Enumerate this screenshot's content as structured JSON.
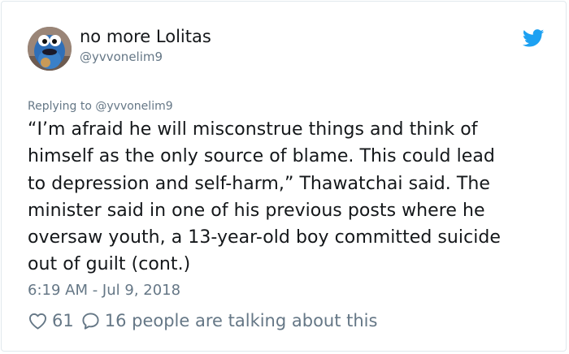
{
  "user": {
    "display_name": "no more Lolitas",
    "handle": "@yvvonelim9",
    "avatar": "cookie-monster-avatar"
  },
  "reply": {
    "prefix": "Replying to",
    "to": "@yvvonelim9"
  },
  "tweet": {
    "lines": [
      "“I’m afraid he will misconstrue things and think of",
      "himself as the only source of blame. This could lead",
      "to depression and self-harm,” Thawatchai said. The",
      "minister said in one of his previous posts where he",
      "oversaw youth, a 13-year-old boy committed suicide",
      "out of guilt (cont.)"
    ]
  },
  "timestamp": "6:19 AM - Jul 9, 2018",
  "footer": {
    "likes": "61",
    "talking": "16 people are talking about this"
  },
  "colors": {
    "twitter_blue": "#1da1f2",
    "text": "#14171a",
    "secondary": "#657786"
  },
  "icons": {
    "brand": "twitter-bird-icon",
    "like": "heart-icon",
    "reply": "speech-bubble-icon"
  }
}
